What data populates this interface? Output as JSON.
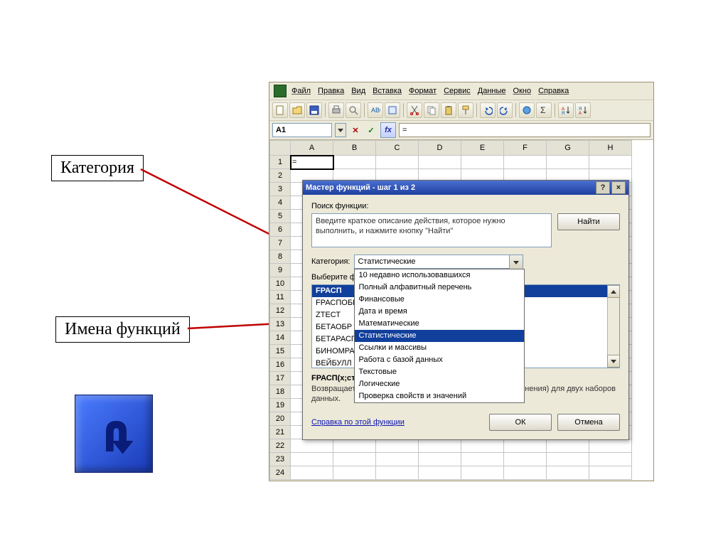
{
  "callouts": {
    "category": "Категория",
    "functions": "Имена функций"
  },
  "menu": {
    "file": "Файл",
    "edit": "Правка",
    "view": "Вид",
    "insert": "Вставка",
    "format": "Формат",
    "tools": "Сервис",
    "data": "Данные",
    "window": "Окно",
    "help": "Справка"
  },
  "namebox": "A1",
  "formula_value": "=",
  "columns": [
    "A",
    "B",
    "C",
    "D",
    "E",
    "F",
    "G",
    "H"
  ],
  "rows_count": 24,
  "active_cell": {
    "row": 1,
    "col": 0,
    "display": "="
  },
  "dialog": {
    "title": "Мастер функций - шаг 1 из 2",
    "search_label": "Поиск функции:",
    "search_text": "Введите краткое описание действия, которое нужно выполнить, и нажмите кнопку \"Найти\"",
    "find_btn": "Найти",
    "category_label": "Категория:",
    "category_selected": "Статистические",
    "category_options": [
      "10 недавно использовавшихся",
      "Полный алфавитный перечень",
      "Финансовые",
      "Дата и время",
      "Математические",
      "Статистические",
      "Ссылки и массивы",
      "Работа с базой данных",
      "Текстовые",
      "Логические",
      "Проверка свойств и значений"
    ],
    "option_highlight_index": 5,
    "select_label": "Выберите функцию:",
    "functions": [
      "FРАСП",
      "FРАСПОБР",
      "ZТЕСТ",
      "БЕТАОБР",
      "БЕТАРАСП",
      "БИНОМРАСП",
      "ВЕЙБУЛЛ"
    ],
    "fn_selected_index": 0,
    "syntax": "FРАСП(x;степени_свободы1;степени_свободы2)",
    "desc": "Возвращает F-распределение вероятности (степень отклонения) для двух наборов данных.",
    "help_link": "Справка по этой функции",
    "ok": "ОК",
    "cancel": "Отмена",
    "help_q": "?",
    "close_x": "×"
  }
}
